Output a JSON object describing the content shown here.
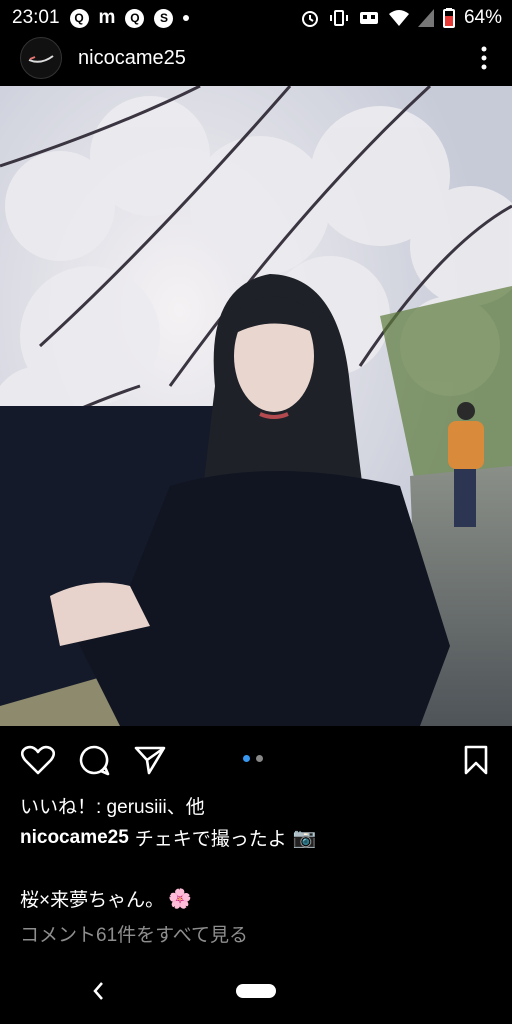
{
  "status_bar": {
    "time": "23:01",
    "left_icons": [
      "Q",
      "m",
      "Q",
      "S"
    ],
    "battery": "64%"
  },
  "post": {
    "username": "nicocame25",
    "likes_text": "いいね！: gerusiii、他",
    "caption_user": "nicocame25",
    "caption_text": "チェキで撮ったよ",
    "caption_emoji": "📷",
    "caption_line2": "桜×来夢ちゃん。",
    "caption_line2_emoji": "🌸",
    "comments_link": "コメント61件をすべて見る",
    "carousel": {
      "count": 2,
      "active": 0,
      "active_color": "#3897f0",
      "inactive_color": "#888888"
    }
  },
  "icons": {
    "like": "heart-icon",
    "comment": "comment-icon",
    "share": "send-icon",
    "save": "bookmark-icon",
    "more": "more-vertical-icon"
  }
}
